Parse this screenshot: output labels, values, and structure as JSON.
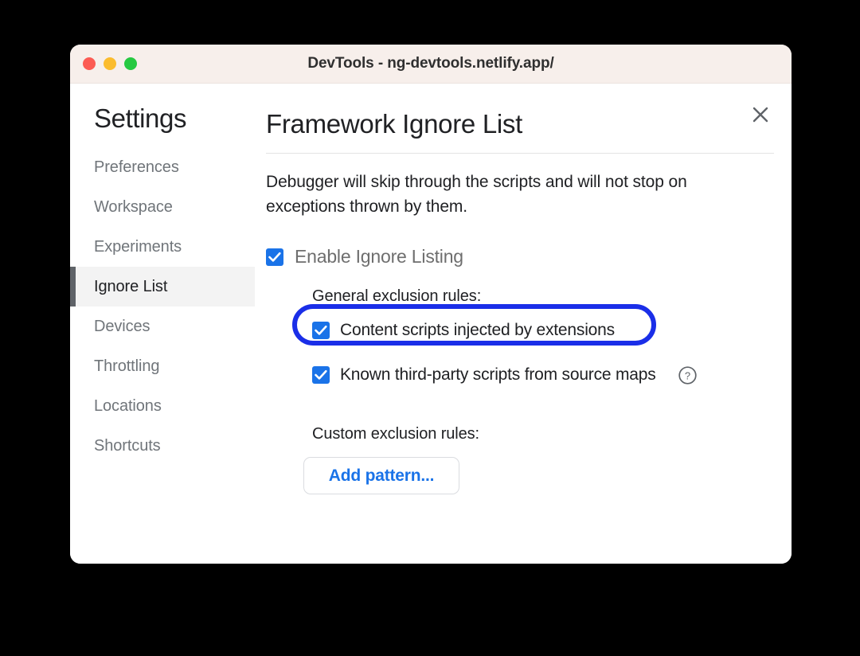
{
  "window": {
    "title": "DevTools - ng-devtools.netlify.app/",
    "traffic_lights": [
      {
        "name": "close",
        "color": "#fc5b53"
      },
      {
        "name": "minimize",
        "color": "#fbbc2e"
      },
      {
        "name": "zoom",
        "color": "#26c941"
      }
    ]
  },
  "sidebar": {
    "heading": "Settings",
    "items": [
      {
        "label": "Preferences",
        "selected": false
      },
      {
        "label": "Workspace",
        "selected": false
      },
      {
        "label": "Experiments",
        "selected": false
      },
      {
        "label": "Ignore List",
        "selected": true
      },
      {
        "label": "Devices",
        "selected": false
      },
      {
        "label": "Throttling",
        "selected": false
      },
      {
        "label": "Locations",
        "selected": false
      },
      {
        "label": "Shortcuts",
        "selected": false
      }
    ]
  },
  "main": {
    "title": "Framework Ignore List",
    "description": "Debugger will skip through the scripts and will not stop on exceptions thrown by them.",
    "close_icon": "close-icon",
    "enable": {
      "label": "Enable Ignore Listing",
      "checked": true
    },
    "general_rules_label": "General exclusion rules:",
    "general_rules": [
      {
        "label": "Content scripts injected by extensions",
        "checked": true,
        "highlighted": true
      },
      {
        "label": "Known third-party scripts from source maps",
        "checked": true,
        "highlighted": false,
        "help_icon": "help-circle-icon"
      }
    ],
    "custom_rules_label": "Custom exclusion rules:",
    "add_pattern_label": "Add pattern..."
  },
  "colors": {
    "accent_blue": "#1a73e8",
    "highlight_ring": "#1a2ee8",
    "titlebar": "#f7efeb",
    "selected_nav_bg": "#f3f3f3",
    "selected_nav_bar": "#5f6368"
  }
}
